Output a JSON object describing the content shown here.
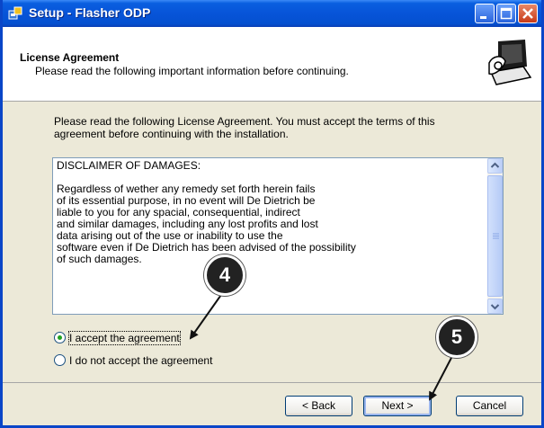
{
  "window": {
    "title": "Setup - Flasher ODP"
  },
  "header": {
    "title": "License Agreement",
    "subtitle": "Please read the following important information before continuing."
  },
  "intro_text": "Please read the following License Agreement. You must accept the terms of this agreement before continuing with the installation.",
  "license": {
    "heading": "DISCLAIMER OF DAMAGES:",
    "body": "Regardless of wether any remedy set forth herein fails\nof its essential purpose, in no event will De Dietrich be\nliable to you for any spacial, consequential, indirect\nand similar damages, including any lost profits and lost\ndata arising out of the use or inability to use the\nsoftware even if De Dietrich has been advised of the possibility\nof such damages."
  },
  "options": {
    "accept_label": "I accept the agreement",
    "decline_label": "I do not accept the agreement",
    "selected": "accept"
  },
  "buttons": {
    "back": "< Back",
    "next": "Next >",
    "cancel": "Cancel"
  },
  "callouts": {
    "step_a": "4",
    "step_b": "5"
  },
  "colors": {
    "titlebar": "#0754d8",
    "dialog_bg": "#ece9d8",
    "radio_selected": "#21a121"
  }
}
